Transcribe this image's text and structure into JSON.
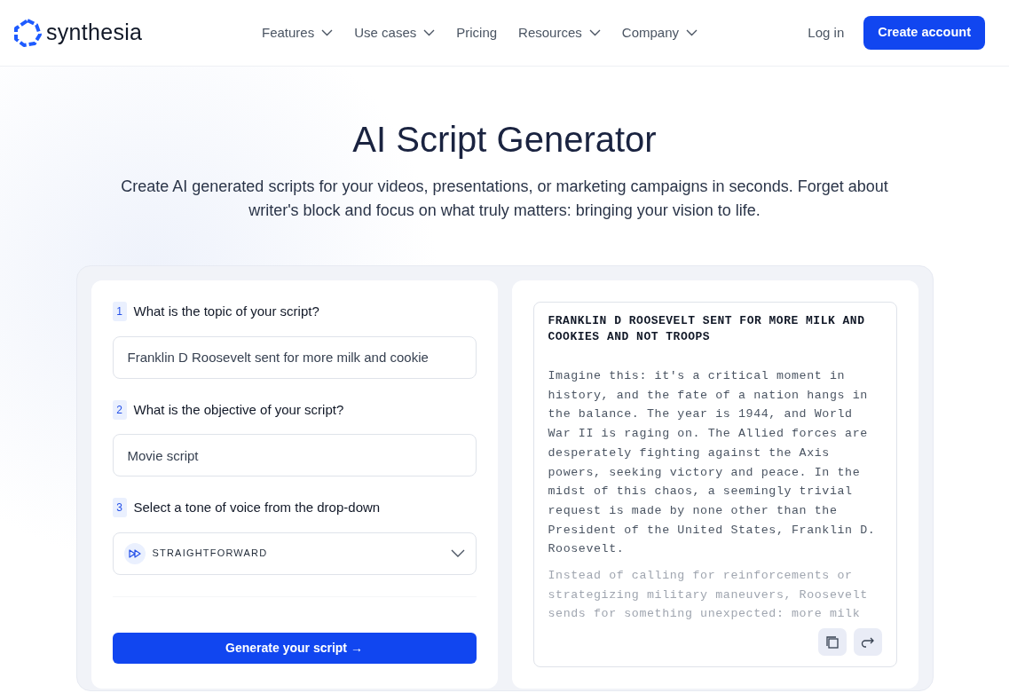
{
  "brand": {
    "name": "synthesia"
  },
  "nav": [
    {
      "label": "Features",
      "dropdown": true
    },
    {
      "label": "Use cases",
      "dropdown": true
    },
    {
      "label": "Pricing",
      "dropdown": false
    },
    {
      "label": "Resources",
      "dropdown": true
    },
    {
      "label": "Company",
      "dropdown": true
    }
  ],
  "actions": {
    "login": "Log in",
    "signup": "Create account"
  },
  "hero": {
    "title": "AI Script Generator",
    "subtitle": "Create AI generated scripts for your videos, presentations, or marketing campaigns in seconds. Forget about writer's block and focus on what truly matters: bringing your vision to life."
  },
  "form": {
    "steps": [
      {
        "number": "1",
        "question": "What is the topic of your script?",
        "kind": "text",
        "value": "Franklin D Roosevelt sent for more milk and cookie"
      },
      {
        "number": "2",
        "question": "What is the objective of your script?",
        "kind": "text",
        "value": "Movie script"
      },
      {
        "number": "3",
        "question": "Select a tone of voice from the drop-down",
        "kind": "select",
        "value": "STRAIGHTFORWARD"
      }
    ],
    "submit": "Generate your script →"
  },
  "output": {
    "title": "FRANKLIN D ROOSEVELT SENT FOR MORE MILK AND COOKIES AND NOT TROOPS",
    "paragraphs": [
      {
        "text": "Imagine this: it's a critical moment in history, and the fate of a nation hangs in the balance. The year is 1944, and World War II is raging on. The Allied forces are desperately fighting against the Axis powers, seeking victory and peace. In the midst of this chaos, a seemingly trivial request is made by none other than the President of the United States, Franklin D. Roosevelt.",
        "faded": false
      },
      {
        "text": "Instead of calling for reinforcements or strategizing military maneuvers, Roosevelt sends for something unexpected: more milk",
        "faded": true
      }
    ]
  }
}
